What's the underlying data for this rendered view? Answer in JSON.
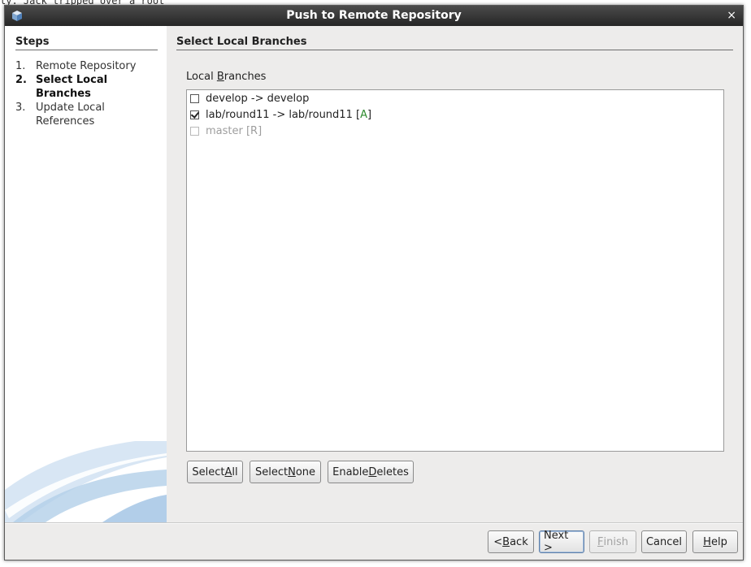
{
  "background": {
    "editor_line": "ly. Jack tripped over a root"
  },
  "dialog": {
    "title": "Push to Remote Repository",
    "close_glyph": "×",
    "icon": "cube-icon"
  },
  "steps": {
    "heading": "Steps",
    "items": [
      {
        "num": "1.",
        "label": "Remote Repository",
        "active": false
      },
      {
        "num": "2.",
        "label": "Select Local Branches",
        "active": true
      },
      {
        "num": "3.",
        "label": "Update Local References",
        "active": false
      }
    ]
  },
  "content": {
    "heading": "Select Local Branches",
    "list_label_prefix": "Local ",
    "list_label_mnemonic": "B",
    "list_label_suffix": "ranches",
    "branches": [
      {
        "name": "develop -> develop",
        "checked": false,
        "enabled": true,
        "tag": ""
      },
      {
        "name": "lab/round11 -> lab/round11 ",
        "checked": true,
        "enabled": true,
        "tag": "[A]"
      },
      {
        "name": "master [R]",
        "checked": false,
        "enabled": false,
        "tag": ""
      }
    ],
    "buttons": {
      "select_all": {
        "pre": "Select ",
        "mn": "A",
        "post": "ll"
      },
      "select_none": {
        "pre": "Select ",
        "mn": "N",
        "post": "one"
      },
      "enable_deletes": {
        "pre": "Enable ",
        "mn": "D",
        "post": "eletes"
      }
    }
  },
  "footer": {
    "back": {
      "pre": "< ",
      "mn": "B",
      "post": "ack"
    },
    "next": "Next >",
    "finish": {
      "mn": "F",
      "post": "inish"
    },
    "cancel": "Cancel",
    "help": {
      "mn": "H",
      "post": "elp"
    }
  },
  "colors": {
    "dialog_bg": "#edeceb",
    "titlebar": "#333333",
    "added_tag": "#2e8b2e"
  }
}
